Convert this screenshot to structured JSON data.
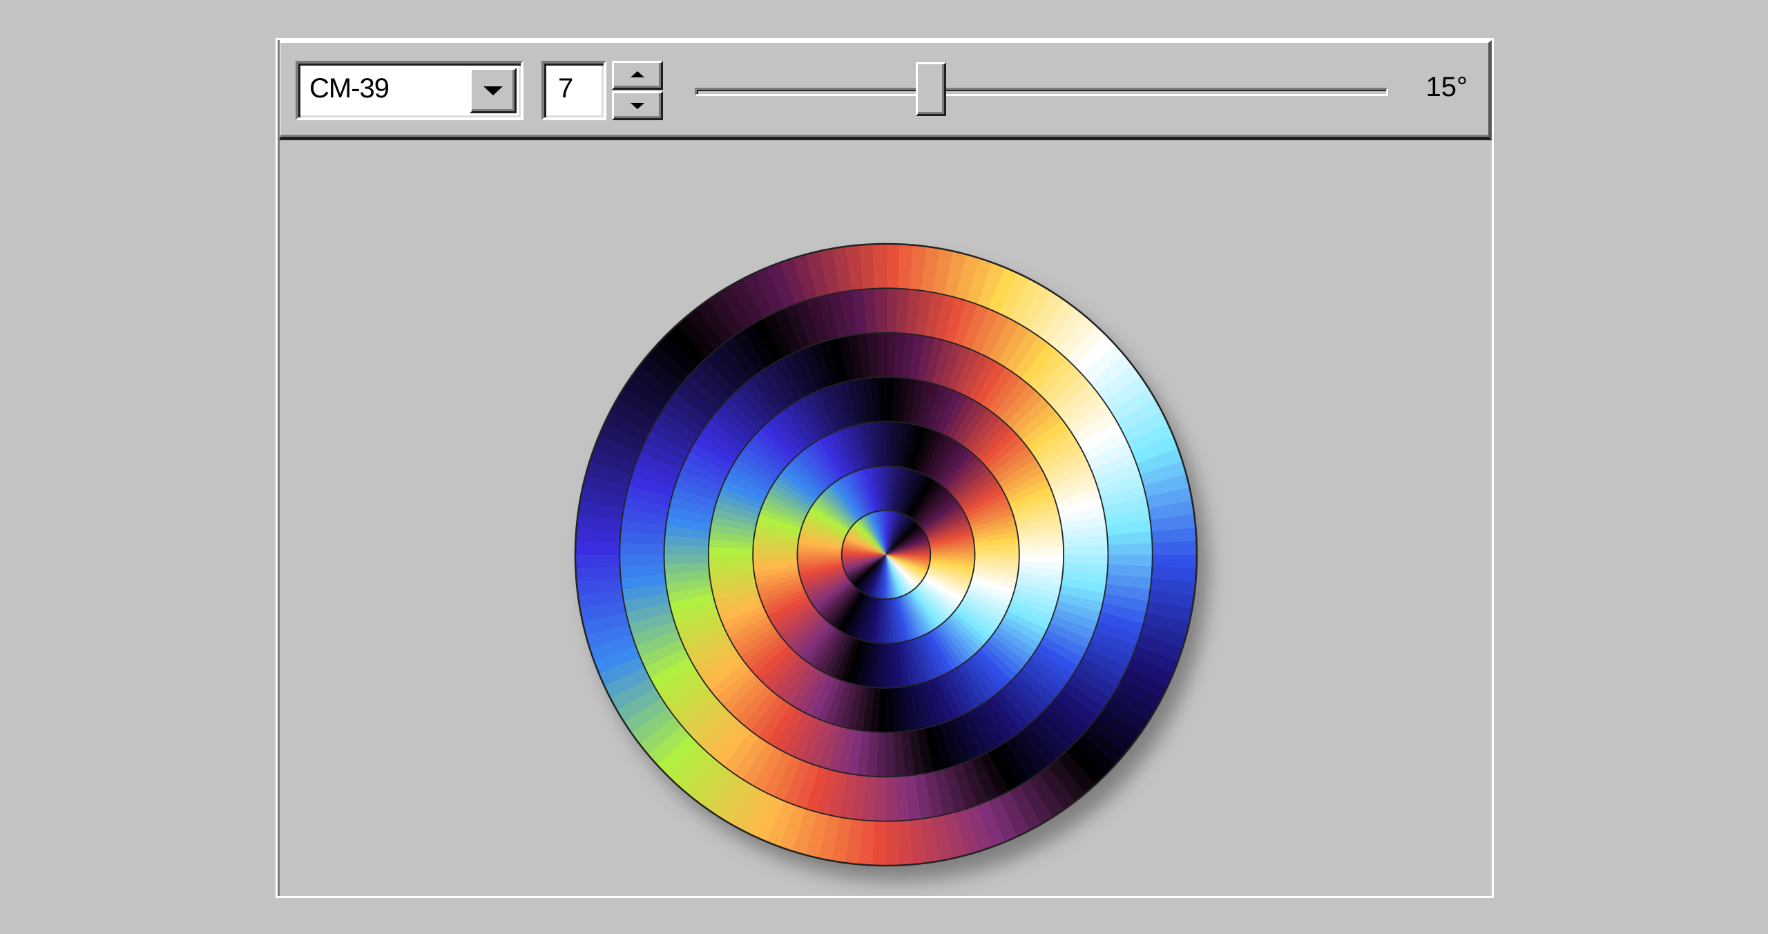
{
  "toolbar": {
    "colormap_select": {
      "value": "CM-39"
    },
    "rings_spinner": {
      "value": "7"
    },
    "rotation_slider": {
      "value_deg": 15,
      "min_deg": 0,
      "max_deg": 45
    },
    "angle_readout": "15°"
  },
  "disc": {
    "ring_count": 7,
    "rotation_deg": 15,
    "colormap": [
      "#3a2fe0",
      "#1d1460",
      "#000000",
      "#5a1850",
      "#e8503a",
      "#ffd850",
      "#ffffff",
      "#7de8ff",
      "#3050e8",
      "#1a1070",
      "#000000",
      "#80307a",
      "#e84a3a",
      "#ffb84a",
      "#b0f040",
      "#3a8af0",
      "#3a2fe0"
    ]
  }
}
